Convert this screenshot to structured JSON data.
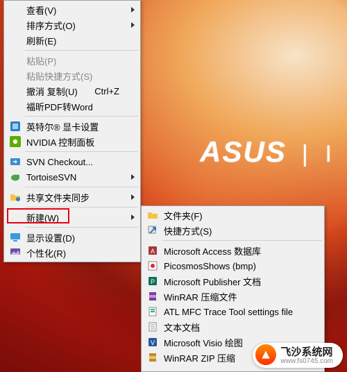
{
  "wallpaper": {
    "brand": "ASUS"
  },
  "mainMenu": {
    "view": "查看(V)",
    "sort": "排序方式(O)",
    "refresh": "刷新(E)",
    "paste": "粘贴(P)",
    "pasteShortcut": "粘贴快捷方式(S)",
    "undoCopy": "撤消 复制(U)",
    "undoKey": "Ctrl+Z",
    "foxitPdf": "福昕PDF转Word",
    "intelGraphics": "英特尔® 显卡设置",
    "nvidia": "NVIDIA 控制面板",
    "svnCheckout": "SVN Checkout...",
    "tortoiseSvn": "TortoiseSVN",
    "folderSync": "共享文件夹同步",
    "new": "新建(W)",
    "displaySettings": "显示设置(D)",
    "personalize": "个性化(R)"
  },
  "subMenu": {
    "folder": "文件夹(F)",
    "shortcut": "快捷方式(S)",
    "access": "Microsoft Access 数据库",
    "picosmos": "PicosmosShows (bmp)",
    "publisher": "Microsoft Publisher 文档",
    "winrar": "WinRAR 压缩文件",
    "atltrace": "ATL MFC Trace Tool settings file",
    "textdoc": "文本文档",
    "visio": "Microsoft Visio 绘图",
    "winrarzip": "WinRAR ZIP 压缩"
  },
  "watermark": {
    "line1": "飞沙系统网",
    "line2": "www.fs0745.com"
  }
}
